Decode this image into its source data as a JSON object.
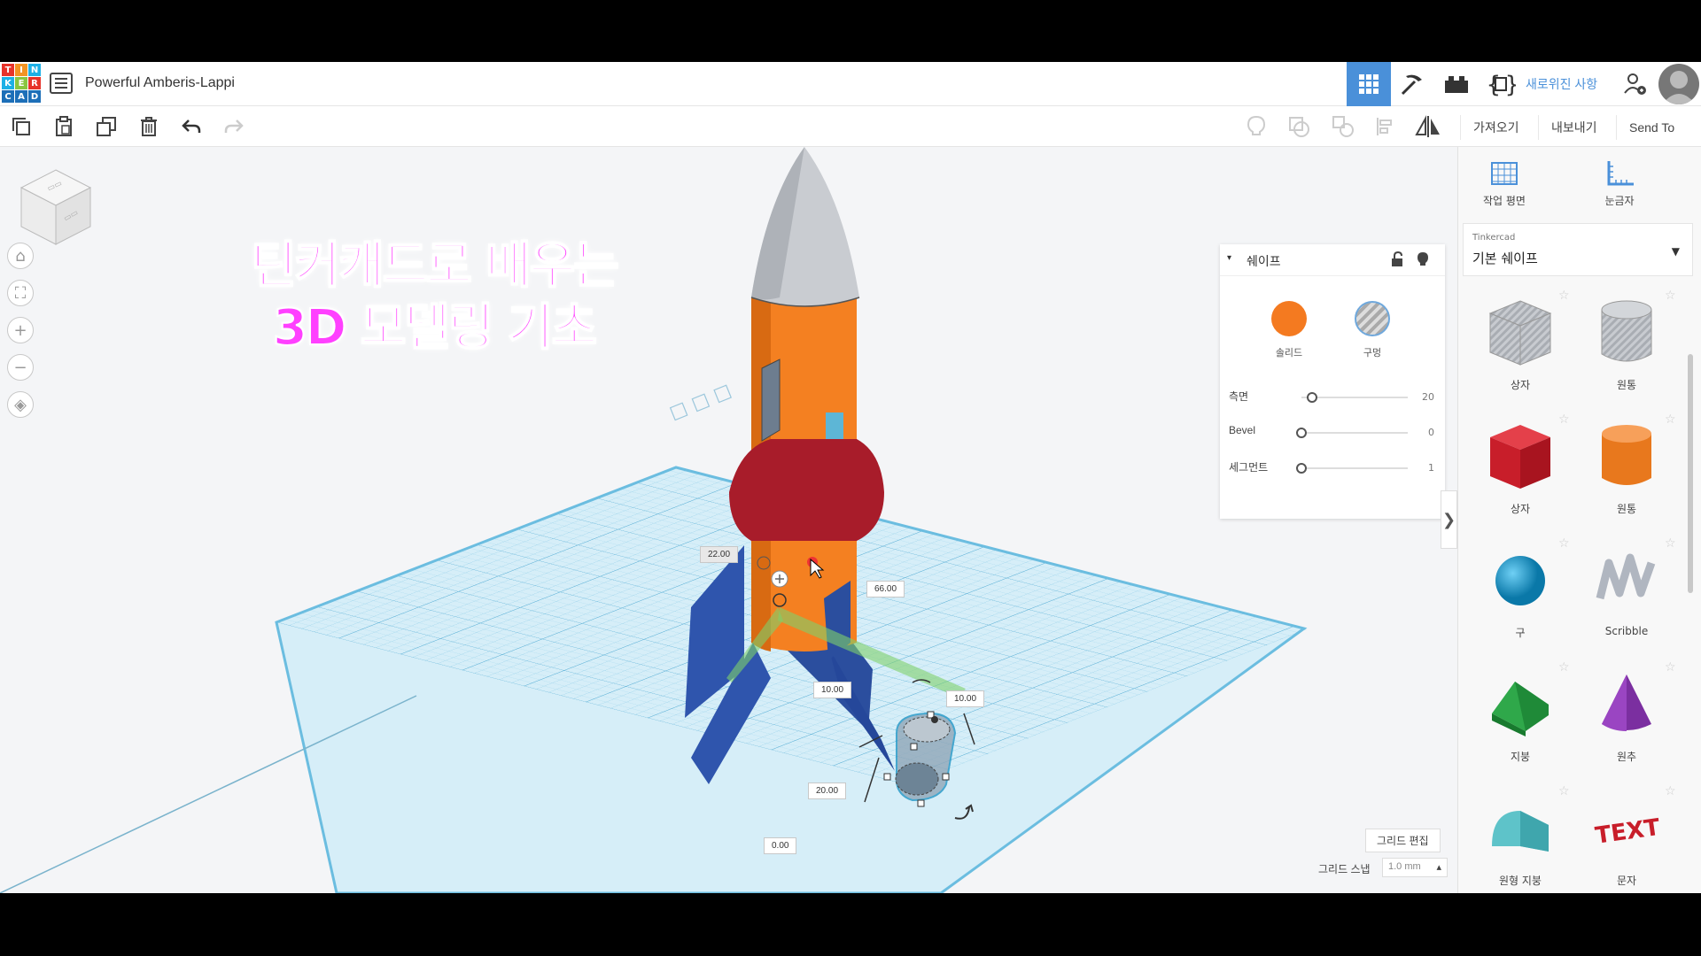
{
  "header": {
    "logo_letters": [
      "T",
      "I",
      "N",
      "K",
      "E",
      "R",
      "C",
      "A",
      "D"
    ],
    "project_name": "Powerful Amberis-Lappi",
    "whats_new": "새로위진 사항"
  },
  "toolbar": {
    "import_label": "가져오기",
    "export_label": "내보내기",
    "send_to_label": "Send To"
  },
  "overlay": {
    "line1": "틴커캐드로 배우는",
    "line2": "3D 모델링 기초"
  },
  "viewport": {
    "dim_22": "22.00",
    "dim_66": "66.00",
    "dim_10a": "10.00",
    "dim_10b": "10.00",
    "dim_20": "20.00",
    "dim_0": "0.00",
    "grid_edit": "그리드 편집",
    "grid_snap": "그리드 스냅",
    "snap_value": "1.0 mm"
  },
  "inspector": {
    "title": "쉐이프",
    "solid_label": "솔리드",
    "hole_label": "구멍",
    "solid_color": "#f47a20",
    "props": [
      {
        "label": "측면",
        "value": "20",
        "fraction": 0.1
      },
      {
        "label": "Bevel",
        "value": "0",
        "fraction": 0.0
      },
      {
        "label": "세그먼트",
        "value": "1",
        "fraction": 0.0
      }
    ]
  },
  "right_panel": {
    "workplane_label": "작업 평면",
    "ruler_label": "눈금자",
    "lib_sub": "Tinkercad",
    "lib_main": "기본 쉐이프",
    "shapes": [
      {
        "name": "상자",
        "icon": "box-hole-icon"
      },
      {
        "name": "원통",
        "icon": "cylinder-hole-icon"
      },
      {
        "name": "상자",
        "icon": "box-icon"
      },
      {
        "name": "원통",
        "icon": "cylinder-icon"
      },
      {
        "name": "구",
        "icon": "sphere-icon"
      },
      {
        "name": "Scribble",
        "icon": "scribble-icon"
      },
      {
        "name": "지붕",
        "icon": "roof-icon"
      },
      {
        "name": "원추",
        "icon": "cone-icon"
      },
      {
        "name": "원형 지붕",
        "icon": "round-roof-icon"
      },
      {
        "name": "문자",
        "icon": "text-icon"
      }
    ]
  }
}
